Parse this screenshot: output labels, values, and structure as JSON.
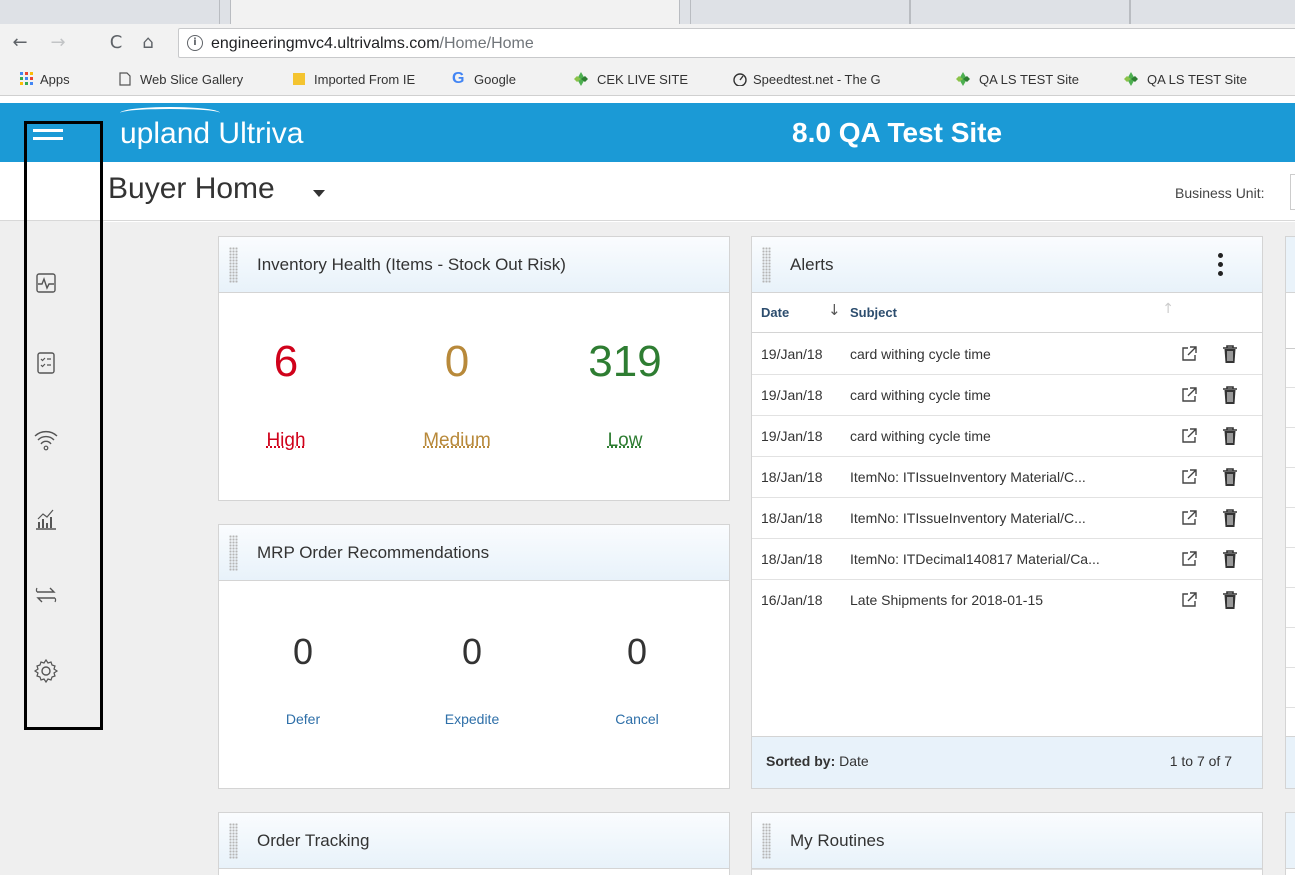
{
  "browser": {
    "url_host": "engineeringmvc4.ultrivalms.com",
    "url_path": "/Home/Home",
    "bookmarks": [
      {
        "label": "Apps",
        "icon": "apps-grid-icon"
      },
      {
        "label": "Web Slice Gallery",
        "icon": "page-icon"
      },
      {
        "label": "Imported From IE",
        "icon": "folder-icon"
      },
      {
        "label": "Google",
        "icon": "google-icon"
      },
      {
        "label": "CEK LIVE SITE",
        "icon": "diamond-icon"
      },
      {
        "label": "Speedtest.net - The G",
        "icon": "speedometer-icon"
      },
      {
        "label": "QA LS TEST Site",
        "icon": "diamond-icon"
      },
      {
        "label": "QA LS TEST Site",
        "icon": "diamond-icon"
      }
    ]
  },
  "header": {
    "logo": "upland Ultriva",
    "site_title": "8.0 QA Test Site"
  },
  "subheader": {
    "page_title": "Buyer Home",
    "business_unit_label": "Business Unit:"
  },
  "rail": {
    "icons": [
      "home-icon",
      "activity-monitor-icon",
      "checklist-icon",
      "wireless-signal-icon",
      "bar-chart-icon",
      "transfer-arrows-icon",
      "settings-gear-icon"
    ]
  },
  "inventory": {
    "title": "Inventory Health (Items - Stock Out Risk)",
    "high_value": "6",
    "high_label": "High",
    "medium_value": "0",
    "medium_label": "Medium",
    "low_value": "319",
    "low_label": "Low",
    "colors": {
      "high": "#d0021b",
      "medium": "#b8893a",
      "low": "#2e7d32"
    }
  },
  "mrp": {
    "title": "MRP Order Recommendations",
    "defer_value": "0",
    "defer_label": "Defer",
    "expedite_value": "0",
    "expedite_label": "Expedite",
    "cancel_value": "0",
    "cancel_label": "Cancel"
  },
  "alerts": {
    "title": "Alerts",
    "col_date": "Date",
    "col_subject": "Subject",
    "rows": [
      {
        "date": "19/Jan/18",
        "subject": "card withing cycle time"
      },
      {
        "date": "19/Jan/18",
        "subject": "card withing cycle time"
      },
      {
        "date": "19/Jan/18",
        "subject": "card withing cycle time"
      },
      {
        "date": "18/Jan/18",
        "subject": "ItemNo: ITIssueInventory Material/C..."
      },
      {
        "date": "18/Jan/18",
        "subject": "ItemNo: ITIssueInventory Material/C..."
      },
      {
        "date": "18/Jan/18",
        "subject": "ItemNo: ITDecimal140817 Material/Ca..."
      },
      {
        "date": "16/Jan/18",
        "subject": "Late Shipments for 2018-01-15"
      }
    ],
    "sorted_by_label": "Sorted by:",
    "sorted_by_value": "Date",
    "count": "1 to 7 of 7"
  },
  "order_tracking": {
    "title": "Order Tracking"
  },
  "my_routines": {
    "title": "My Routines"
  }
}
